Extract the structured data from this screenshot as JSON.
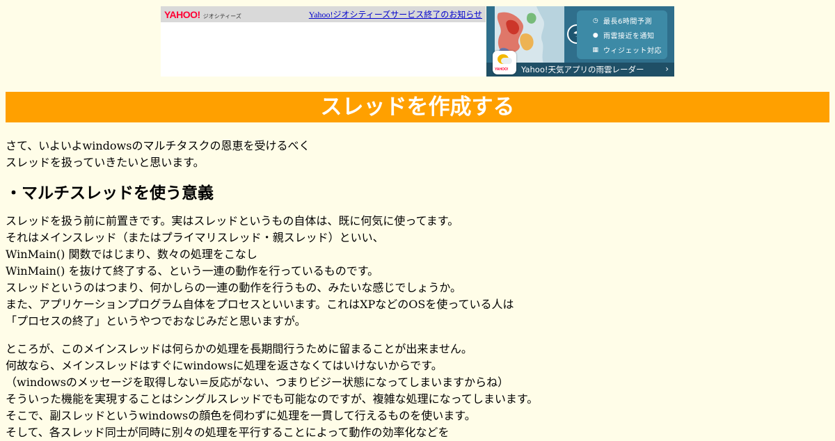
{
  "banner": {
    "geo_logo_yahoo": "YAHOO!",
    "geo_logo_sub": "ジオシティーズ",
    "notice_link": "Yahoo!ジオシティーズサービス終了のお知らせ",
    "weather_ad": {
      "features": [
        "最長6時間予測",
        "雨雲接近を通知",
        "ウィジェット対応"
      ],
      "footer": "Yahoo!天気アプリの雨雲レーダー",
      "app_icon_label": "YAHOO!"
    }
  },
  "title": "スレッドを作成する",
  "intro": [
    "さて、いよいよwindowsのマルチタスクの恩恵を受けるべく",
    "スレッドを扱っていきたいと思います。"
  ],
  "section1": {
    "heading": "・マルチスレッドを使う意義",
    "para1": [
      "スレッドを扱う前に前置きです。実はスレッドというもの自体は、既に何気に使ってます。",
      "それはメインスレッド（またはプライマリスレッド・親スレッド）といい、",
      "WinMain() 関数ではじまり、数々の処理をこなし",
      "WinMain() を抜けて終了する、という一連の動作を行っているものです。",
      "スレッドというのはつまり、何かしらの一連の動作を行うもの、みたいな感じでしょうか。",
      "また、アプリケーションプログラム自体をプロセスといいます。これはXPなどのOSを使っている人は",
      "「プロセスの終了」というやつでおなじみだと思いますが。"
    ],
    "para2": [
      "ところが、このメインスレッドは何らかの処理を長期間行うために留まることが出来ません。",
      "何故なら、メインスレッドはすぐにwindowsに処理を返さなくてはいけないからです。",
      "（windowsのメッセージを取得しない=反応がない、つまりビジー状態になってしまいますからね）",
      "そういった機能を実現することはシングルスレッドでも可能なのですが、複雑な処理になってしまいます。",
      "そこで、副スレッドというwindowsの顔色を伺わずに処理を一貫して行えるものを使います。",
      "そして、各スレッド同士が同時に別々の処理を平行することによって動作の効率化などを"
    ]
  }
}
